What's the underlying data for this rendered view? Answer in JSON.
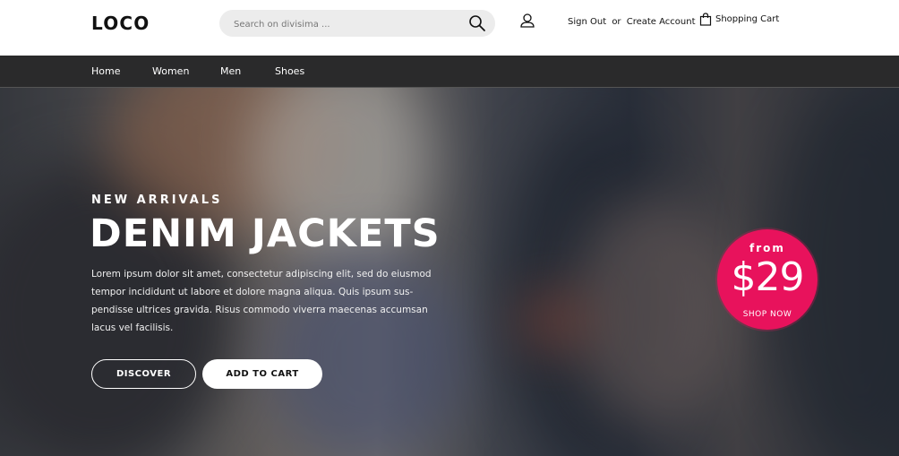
{
  "header": {
    "logo": "LOCO",
    "search": {
      "placeholder": "Search on divisima ..."
    },
    "account": {
      "sign_out": "Sign Out",
      "separator": "or",
      "create_account": "Create Account"
    },
    "cart_label": "Shopping Cart"
  },
  "nav": {
    "items": [
      {
        "label": "Home"
      },
      {
        "label": "Women"
      },
      {
        "label": "Men"
      },
      {
        "label": "Shoes"
      }
    ]
  },
  "hero": {
    "eyebrow": "NEW ARRIVALS",
    "headline": "DENIM JACKETS",
    "description": "Lorem ipsum dolor sit amet, consectetur adipiscing elit, sed do eiusmod tempor incididunt ut labore et dolore magna aliqua. Quis ipsum sus-pendisse ultrices gravida. Risus commodo viverra maecenas accumsan lacus vel facilisis.",
    "buttons": {
      "discover": "DISCOVER",
      "add_to_cart": "ADD TO CART"
    },
    "price_badge": {
      "from": "from",
      "amount": "$29",
      "cta": "SHOP NOW",
      "color": "#e8125c"
    }
  },
  "icons": {
    "search": "search-icon",
    "user": "user-icon",
    "cart": "shopping-bag-icon"
  }
}
